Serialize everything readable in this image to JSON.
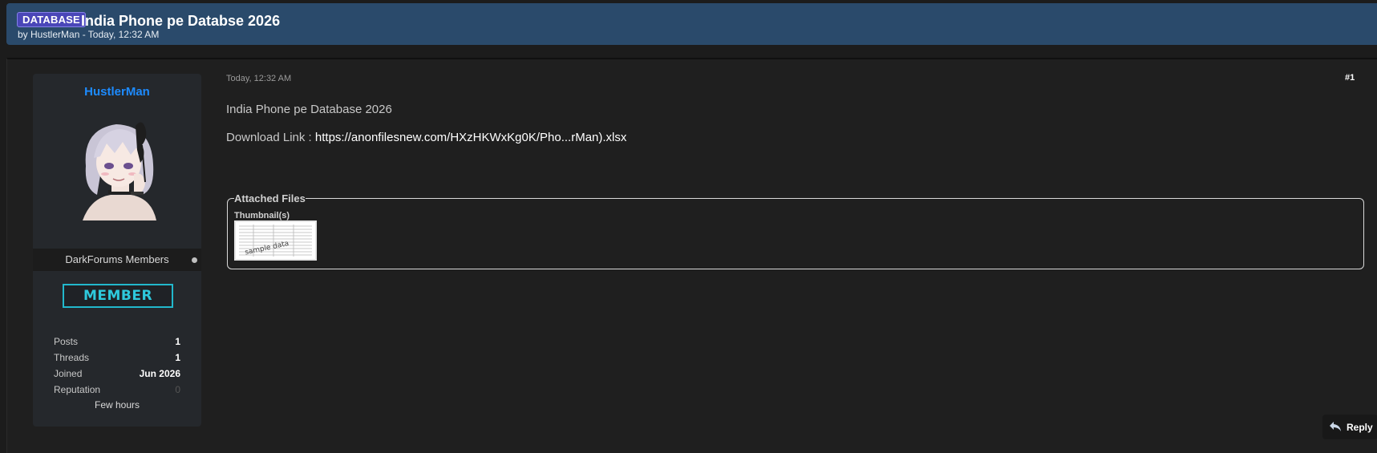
{
  "thread": {
    "prefix": "DATABASE",
    "title": "India Phone pe Databse 2026",
    "byline": "by HustlerMan - Today, 12:32 AM"
  },
  "author": {
    "name": "HustlerMan",
    "usergroup": "DarkForums Members",
    "rank": "MEMBER",
    "stats": [
      {
        "label": "Posts",
        "value": "1"
      },
      {
        "label": "Threads",
        "value": "1"
      },
      {
        "label": "Joined",
        "value": "Jun 2026"
      },
      {
        "label": "Reputation",
        "value": "0"
      }
    ],
    "last_active": "Few hours"
  },
  "post": {
    "date": "Today, 12:32 AM",
    "number": "#1",
    "line1": "India Phone pe Database 2026",
    "download_label": "Download Link :",
    "download_link": "https://anonfilesnew.com/HXzHKWxKg0K/Pho...rMan).xlsx"
  },
  "attachments": {
    "legend": "Attached Files",
    "thumbs_label": "Thumbnail(s)",
    "watermark": "sample data"
  },
  "actions": {
    "reply_label": "Reply"
  },
  "icons": {
    "reply": "reply-arrow-icon",
    "online": "online-status-icon"
  },
  "colors": {
    "header_bg": "#2a4a6b",
    "prefix_bg": "#4a46b8",
    "username": "#1d8bff",
    "rank_accent": "#22b8cc"
  }
}
